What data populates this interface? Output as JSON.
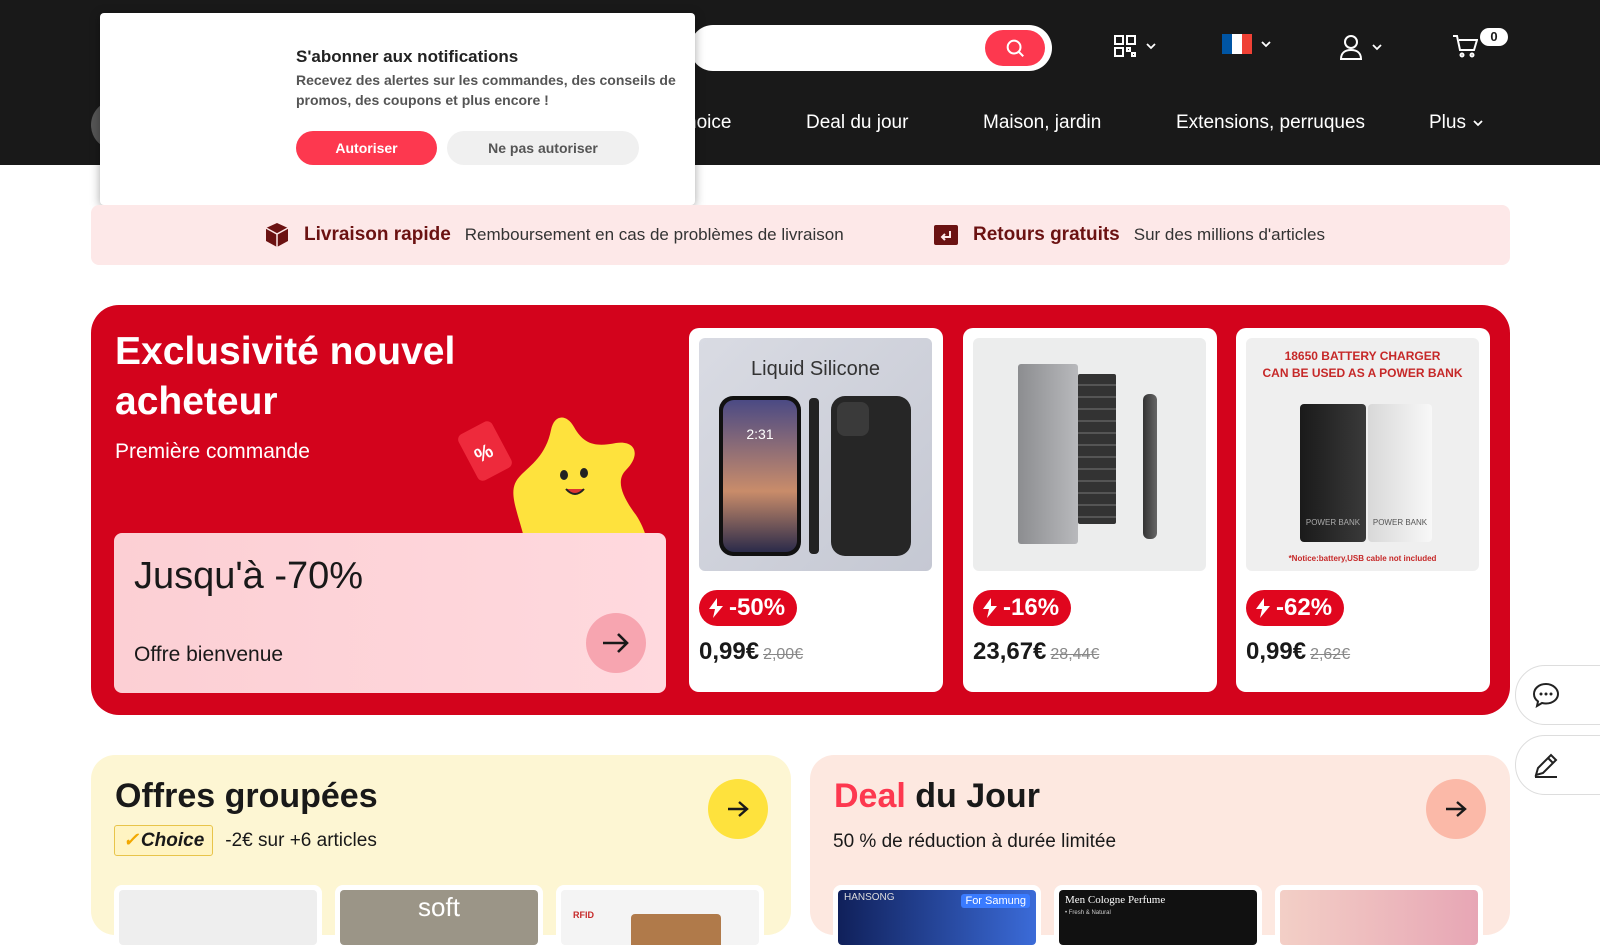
{
  "header": {
    "cart_count": "0",
    "nav": [
      "hoice",
      "Deal du jour",
      "Maison, jardin",
      "Extensions, perruques",
      "Plus"
    ],
    "flag_colors": [
      "#0055a4",
      "#ffffff",
      "#ef4135"
    ]
  },
  "popup": {
    "title": "S'abonner aux notifications",
    "text": "Recevez des alertes sur les commandes, des conseils de promos, des coupons et plus encore !",
    "allow": "Autoriser",
    "deny": "Ne pas autoriser"
  },
  "shipping": {
    "fast_title": "Livraison rapide",
    "fast_text": "Remboursement en cas de problèmes de livraison",
    "returns_title": "Retours gratuits",
    "returns_text": "Sur des millions d'articles"
  },
  "hero": {
    "title": "Exclusivité nouvel acheteur",
    "subtitle": "Première commande",
    "promo_big": "Jusqu'à -70%",
    "promo_small": "Offre bienvenue",
    "products": [
      {
        "discount": "-50%",
        "price": "0,99€",
        "old_price": "2,00€",
        "img_title": "Liquid Silicone",
        "phone_time": "2:31"
      },
      {
        "discount": "-16%",
        "price": "23,67€",
        "old_price": "28,44€"
      },
      {
        "discount": "-62%",
        "price": "0,99€",
        "old_price": "2,62€",
        "img_title_1": "18650 BATTERY CHARGER",
        "img_title_2": "CAN BE USED AS A POWER BANK",
        "img_label_1": "POWER BANK",
        "img_label_2": "POWER BANK",
        "img_note": "*Notice:battery,USB cable not included"
      }
    ]
  },
  "bundles": {
    "title": "Offres groupées",
    "badge": "Choice",
    "text": "-2€ sur +6 articles",
    "thumb_text": "soft",
    "thumb_rfid": "RFID"
  },
  "deal": {
    "title_red": "Deal",
    "title_rest": " du Jour",
    "text": "50 % de réduction à durée limitée",
    "thumb1_brand": "HANSONG",
    "thumb1_tag": "For Samung",
    "thumb2_title": "Men Cologne Perfume",
    "thumb2_sub": "• Fresh & Natural"
  },
  "colors": {
    "accent": "#fd384f",
    "hero_red": "#d3031c",
    "bundles_bg": "#fdf6d3",
    "deal_bg": "#fde8e0"
  }
}
